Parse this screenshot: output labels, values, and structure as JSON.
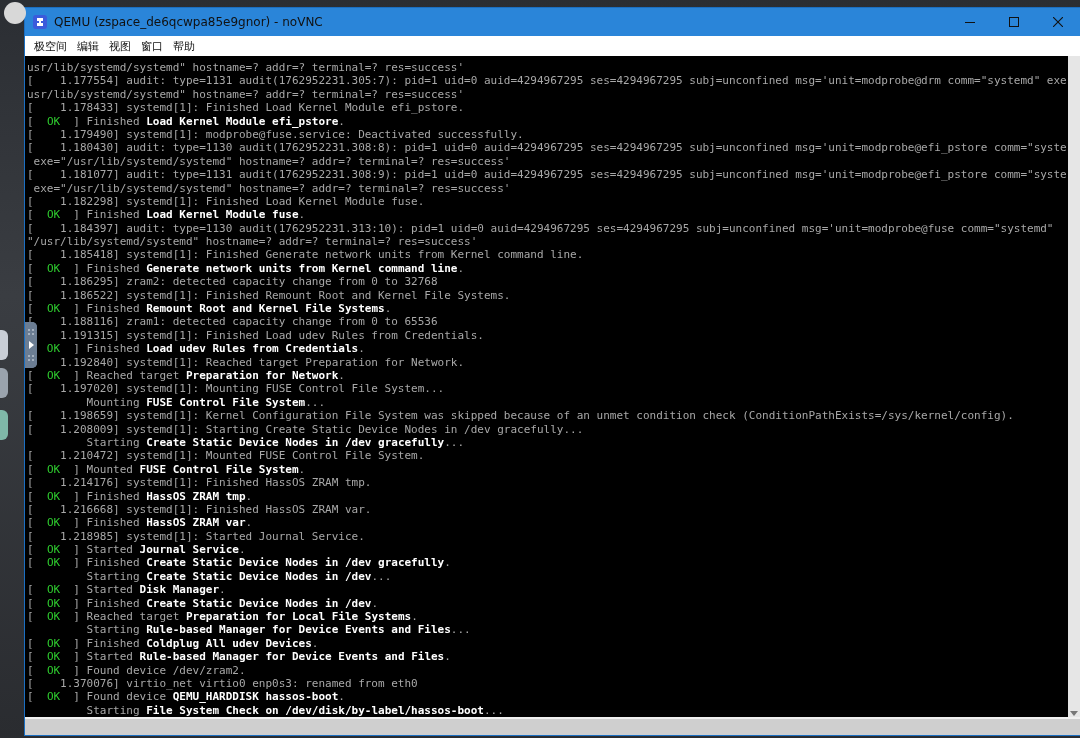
{
  "window": {
    "title": "QEMU (zspace_de6qcwpa85e9gnor) - noVNC"
  },
  "menu": [
    "极空间",
    "编辑",
    "视图",
    "窗口",
    "帮助"
  ],
  "terminal": {
    "lines": [
      [
        {
          "kind": "dim",
          "text": "usr/lib/systemd/systemd\" hostname=? addr=? terminal=? res=success'"
        }
      ],
      [
        {
          "kind": "dim",
          "text": "[    1.177554] audit: type=1131 audit(1762952231.305:7): pid=1 uid=0 auid=4294967295 ses=4294967295 subj=unconfined msg='unit=modprobe@drm comm=\"systemd\" exe"
        }
      ],
      [
        {
          "kind": "dim",
          "text": "usr/lib/systemd/systemd\" hostname=? addr=? terminal=? res=success'"
        }
      ],
      [
        {
          "kind": "dim",
          "text": "[    1.178433] systemd[1]: Finished Load Kernel Module efi_pstore."
        }
      ],
      [
        {
          "kind": "dim",
          "text": "[  "
        },
        {
          "kind": "ok",
          "text": "OK"
        },
        {
          "kind": "dim",
          "text": "  ] Finished "
        },
        {
          "kind": "bright",
          "text": "Load Kernel Module efi_pstore"
        },
        {
          "kind": "dim",
          "text": "."
        }
      ],
      [
        {
          "kind": "dim",
          "text": "[    1.179490] systemd[1]: modprobe@fuse.service: Deactivated successfully."
        }
      ],
      [
        {
          "kind": "dim",
          "text": "[    1.180430] audit: type=1130 audit(1762952231.308:8): pid=1 uid=0 auid=4294967295 ses=4294967295 subj=unconfined msg='unit=modprobe@efi_pstore comm=\"syste"
        }
      ],
      [
        {
          "kind": "dim",
          "text": " exe=\"/usr/lib/systemd/systemd\" hostname=? addr=? terminal=? res=success'"
        }
      ],
      [
        {
          "kind": "dim",
          "text": "[    1.181077] audit: type=1131 audit(1762952231.308:9): pid=1 uid=0 auid=4294967295 ses=4294967295 subj=unconfined msg='unit=modprobe@efi_pstore comm=\"syste"
        }
      ],
      [
        {
          "kind": "dim",
          "text": " exe=\"/usr/lib/systemd/systemd\" hostname=? addr=? terminal=? res=success'"
        }
      ],
      [
        {
          "kind": "dim",
          "text": "[    1.182298] systemd[1]: Finished Load Kernel Module fuse."
        }
      ],
      [
        {
          "kind": "dim",
          "text": "[  "
        },
        {
          "kind": "ok",
          "text": "OK"
        },
        {
          "kind": "dim",
          "text": "  ] Finished "
        },
        {
          "kind": "bright",
          "text": "Load Kernel Module fuse"
        },
        {
          "kind": "dim",
          "text": "."
        }
      ],
      [
        {
          "kind": "dim",
          "text": "[    1.184397] audit: type=1130 audit(1762952231.313:10): pid=1 uid=0 auid=4294967295 ses=4294967295 subj=unconfined msg='unit=modprobe@fuse comm=\"systemd\""
        }
      ],
      [
        {
          "kind": "dim",
          "text": "\"/usr/lib/systemd/systemd\" hostname=? addr=? terminal=? res=success'"
        }
      ],
      [
        {
          "kind": "dim",
          "text": "[    1.185418] systemd[1]: Finished Generate network units from Kernel command line."
        }
      ],
      [
        {
          "kind": "dim",
          "text": "[  "
        },
        {
          "kind": "ok",
          "text": "OK"
        },
        {
          "kind": "dim",
          "text": "  ] Finished "
        },
        {
          "kind": "bright",
          "text": "Generate network units from Kernel command line"
        },
        {
          "kind": "dim",
          "text": "."
        }
      ],
      [
        {
          "kind": "dim",
          "text": "[    1.186295] zram2: detected capacity change from 0 to 32768"
        }
      ],
      [
        {
          "kind": "dim",
          "text": "[    1.186522] systemd[1]: Finished Remount Root and Kernel File Systems."
        }
      ],
      [
        {
          "kind": "dim",
          "text": "[  "
        },
        {
          "kind": "ok",
          "text": "OK"
        },
        {
          "kind": "dim",
          "text": "  ] Finished "
        },
        {
          "kind": "bright",
          "text": "Remount Root and Kernel File Systems"
        },
        {
          "kind": "dim",
          "text": "."
        }
      ],
      [
        {
          "kind": "dim",
          "text": "[    1.188116] zram1: detected capacity change from 0 to 65536"
        }
      ],
      [
        {
          "kind": "dim",
          "text": "     1.191315] systemd[1]: Finished Load udev Rules from Credentials."
        }
      ],
      [
        {
          "kind": "ok",
          "text": "   OK"
        },
        {
          "kind": "dim",
          "text": "  ] Finished "
        },
        {
          "kind": "bright",
          "text": "Load udev Rules from Credentials"
        },
        {
          "kind": "dim",
          "text": "."
        }
      ],
      [
        {
          "kind": "dim",
          "text": "     1.192840] systemd[1]: Reached target Preparation for Network."
        }
      ],
      [
        {
          "kind": "dim",
          "text": "[  "
        },
        {
          "kind": "ok",
          "text": "OK"
        },
        {
          "kind": "dim",
          "text": "  ] Reached target "
        },
        {
          "kind": "bright",
          "text": "Preparation for Network"
        },
        {
          "kind": "dim",
          "text": "."
        }
      ],
      [
        {
          "kind": "dim",
          "text": "[    1.197020] systemd[1]: Mounting FUSE Control File System..."
        }
      ],
      [
        {
          "kind": "dim",
          "text": "         Mounting "
        },
        {
          "kind": "bright",
          "text": "FUSE Control File System"
        },
        {
          "kind": "dim",
          "text": "..."
        }
      ],
      [
        {
          "kind": "dim",
          "text": "[    1.198659] systemd[1]: Kernel Configuration File System was skipped because of an unmet condition check (ConditionPathExists=/sys/kernel/config)."
        }
      ],
      [
        {
          "kind": "dim",
          "text": "[    1.208009] systemd[1]: Starting Create Static Device Nodes in /dev gracefully..."
        }
      ],
      [
        {
          "kind": "dim",
          "text": "         Starting "
        },
        {
          "kind": "bright",
          "text": "Create Static Device Nodes in /dev gracefully"
        },
        {
          "kind": "dim",
          "text": "..."
        }
      ],
      [
        {
          "kind": "dim",
          "text": "[    1.210472] systemd[1]: Mounted FUSE Control File System."
        }
      ],
      [
        {
          "kind": "dim",
          "text": "[  "
        },
        {
          "kind": "ok",
          "text": "OK"
        },
        {
          "kind": "dim",
          "text": "  ] Mounted "
        },
        {
          "kind": "bright",
          "text": "FUSE Control File System"
        },
        {
          "kind": "dim",
          "text": "."
        }
      ],
      [
        {
          "kind": "dim",
          "text": "[    1.214176] systemd[1]: Finished HassOS ZRAM tmp."
        }
      ],
      [
        {
          "kind": "dim",
          "text": "[  "
        },
        {
          "kind": "ok",
          "text": "OK"
        },
        {
          "kind": "dim",
          "text": "  ] Finished "
        },
        {
          "kind": "bright",
          "text": "HassOS ZRAM tmp"
        },
        {
          "kind": "dim",
          "text": "."
        }
      ],
      [
        {
          "kind": "dim",
          "text": "[    1.216668] systemd[1]: Finished HassOS ZRAM var."
        }
      ],
      [
        {
          "kind": "dim",
          "text": "[  "
        },
        {
          "kind": "ok",
          "text": "OK"
        },
        {
          "kind": "dim",
          "text": "  ] Finished "
        },
        {
          "kind": "bright",
          "text": "HassOS ZRAM var"
        },
        {
          "kind": "dim",
          "text": "."
        }
      ],
      [
        {
          "kind": "dim",
          "text": "[    1.218985] systemd[1]: Started Journal Service."
        }
      ],
      [
        {
          "kind": "dim",
          "text": "[  "
        },
        {
          "kind": "ok",
          "text": "OK"
        },
        {
          "kind": "dim",
          "text": "  ] Started "
        },
        {
          "kind": "bright",
          "text": "Journal Service"
        },
        {
          "kind": "dim",
          "text": "."
        }
      ],
      [
        {
          "kind": "dim",
          "text": "[  "
        },
        {
          "kind": "ok",
          "text": "OK"
        },
        {
          "kind": "dim",
          "text": "  ] Finished "
        },
        {
          "kind": "bright",
          "text": "Create Static Device Nodes in /dev gracefully"
        },
        {
          "kind": "dim",
          "text": "."
        }
      ],
      [
        {
          "kind": "dim",
          "text": "         Starting "
        },
        {
          "kind": "bright",
          "text": "Create Static Device Nodes in /dev"
        },
        {
          "kind": "dim",
          "text": "..."
        }
      ],
      [
        {
          "kind": "dim",
          "text": "[  "
        },
        {
          "kind": "ok",
          "text": "OK"
        },
        {
          "kind": "dim",
          "text": "  ] Started "
        },
        {
          "kind": "bright",
          "text": "Disk Manager"
        },
        {
          "kind": "dim",
          "text": "."
        }
      ],
      [
        {
          "kind": "dim",
          "text": "[  "
        },
        {
          "kind": "ok",
          "text": "OK"
        },
        {
          "kind": "dim",
          "text": "  ] Finished "
        },
        {
          "kind": "bright",
          "text": "Create Static Device Nodes in /dev"
        },
        {
          "kind": "dim",
          "text": "."
        }
      ],
      [
        {
          "kind": "dim",
          "text": "[  "
        },
        {
          "kind": "ok",
          "text": "OK"
        },
        {
          "kind": "dim",
          "text": "  ] Reached target "
        },
        {
          "kind": "bright",
          "text": "Preparation for Local File Systems"
        },
        {
          "kind": "dim",
          "text": "."
        }
      ],
      [
        {
          "kind": "dim",
          "text": "         Starting "
        },
        {
          "kind": "bright",
          "text": "Rule-based Manager for Device Events and Files"
        },
        {
          "kind": "dim",
          "text": "..."
        }
      ],
      [
        {
          "kind": "dim",
          "text": "[  "
        },
        {
          "kind": "ok",
          "text": "OK"
        },
        {
          "kind": "dim",
          "text": "  ] Finished "
        },
        {
          "kind": "bright",
          "text": "Coldplug All udev Devices"
        },
        {
          "kind": "dim",
          "text": "."
        }
      ],
      [
        {
          "kind": "dim",
          "text": "[  "
        },
        {
          "kind": "ok",
          "text": "OK"
        },
        {
          "kind": "dim",
          "text": "  ] Started "
        },
        {
          "kind": "bright",
          "text": "Rule-based Manager for Device Events and Files"
        },
        {
          "kind": "dim",
          "text": "."
        }
      ],
      [
        {
          "kind": "dim",
          "text": "[  "
        },
        {
          "kind": "ok",
          "text": "OK"
        },
        {
          "kind": "dim",
          "text": "  ] Found device /dev/zram2."
        }
      ],
      [
        {
          "kind": "dim",
          "text": "[    1.370076] virtio_net virtio0 enp0s3: renamed from eth0"
        }
      ],
      [
        {
          "kind": "dim",
          "text": "[  "
        },
        {
          "kind": "ok",
          "text": "OK"
        },
        {
          "kind": "dim",
          "text": "  ] Found device "
        },
        {
          "kind": "bright",
          "text": "QEMU_HARDDISK hassos-boot"
        },
        {
          "kind": "dim",
          "text": "."
        }
      ],
      [
        {
          "kind": "dim",
          "text": "         Starting "
        },
        {
          "kind": "bright",
          "text": "File System Check on /dev/disk/by-label/hassos-boot"
        },
        {
          "kind": "dim",
          "text": "..."
        }
      ]
    ]
  }
}
